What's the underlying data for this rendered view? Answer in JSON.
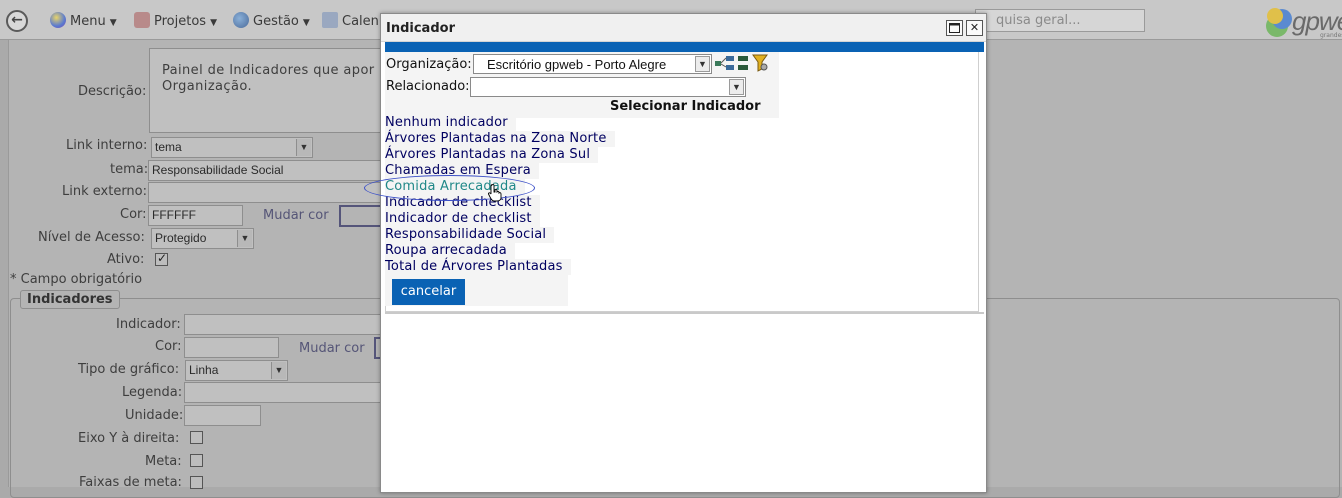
{
  "topbar": {
    "menus": [
      {
        "label": "Menu",
        "icon": "orb-icon"
      },
      {
        "label": "Projetos",
        "icon": "puzzle-icon"
      },
      {
        "label": "Gestão",
        "icon": "globe-icon"
      },
      {
        "label": "Calen",
        "icon": "calendar-icon"
      }
    ],
    "search_placeholder": "quisa geral...",
    "logo_text": "gpweb",
    "logo_sub": "grandes"
  },
  "form": {
    "descricao_label": "Descrição:",
    "descricao_value": "Painel de Indicadores que apor Organização.",
    "link_interno_label": "Link interno:",
    "link_interno_value": "tema",
    "tema_label": "tema:",
    "tema_value": "Responsabilidade Social",
    "link_externo_label": "Link externo:",
    "cor_label": "Cor:",
    "cor_value": "FFFFFF",
    "mudar_cor": "Mudar cor",
    "nivel_label": "Nível de Acesso:",
    "nivel_value": "Protegido",
    "ativo_label": "Ativo:",
    "campo_obrigatorio": "* Campo obrigatório",
    "indicadores_legend": "Indicadores",
    "indicador_label": "Indicador:",
    "ind_cor_label": "Cor:",
    "ind_mudar_cor": "Mudar cor",
    "tipo_label": "Tipo de gráfico:",
    "tipo_value": "Linha",
    "legenda_label": "Legenda:",
    "unidade_label": "Unidade:",
    "eixo_label": "Eixo Y à direita:",
    "meta_label": "Meta:",
    "faixas_label": "Faixas de meta:"
  },
  "dialog": {
    "title": "Indicador",
    "organizacao_label": "Organização:",
    "organizacao_value": "Escritório gpweb - Porto Alegre",
    "relacionado_label": "Relacionado:",
    "relacionado_value": "",
    "heading": "Selecionar Indicador",
    "items": [
      "Nenhum indicador",
      "Árvores Plantadas na Zona Norte",
      "Árvores Plantadas na Zona Sul",
      "Chamadas em Espera",
      "Comida Arrecadada",
      "Indicador de checklist",
      "Indicador de checklist",
      "Responsabilidade Social",
      "Roupa arrecadada",
      "Total de Árvores Plantadas"
    ],
    "hovered_item": "Comida Arrecadada",
    "cancel_label": "cancelar"
  },
  "colors": {
    "accent_blue": "#0a62b4",
    "link_navy": "#000060",
    "hover_teal": "#208888",
    "annotation_ellipse": "#3c50c8"
  }
}
